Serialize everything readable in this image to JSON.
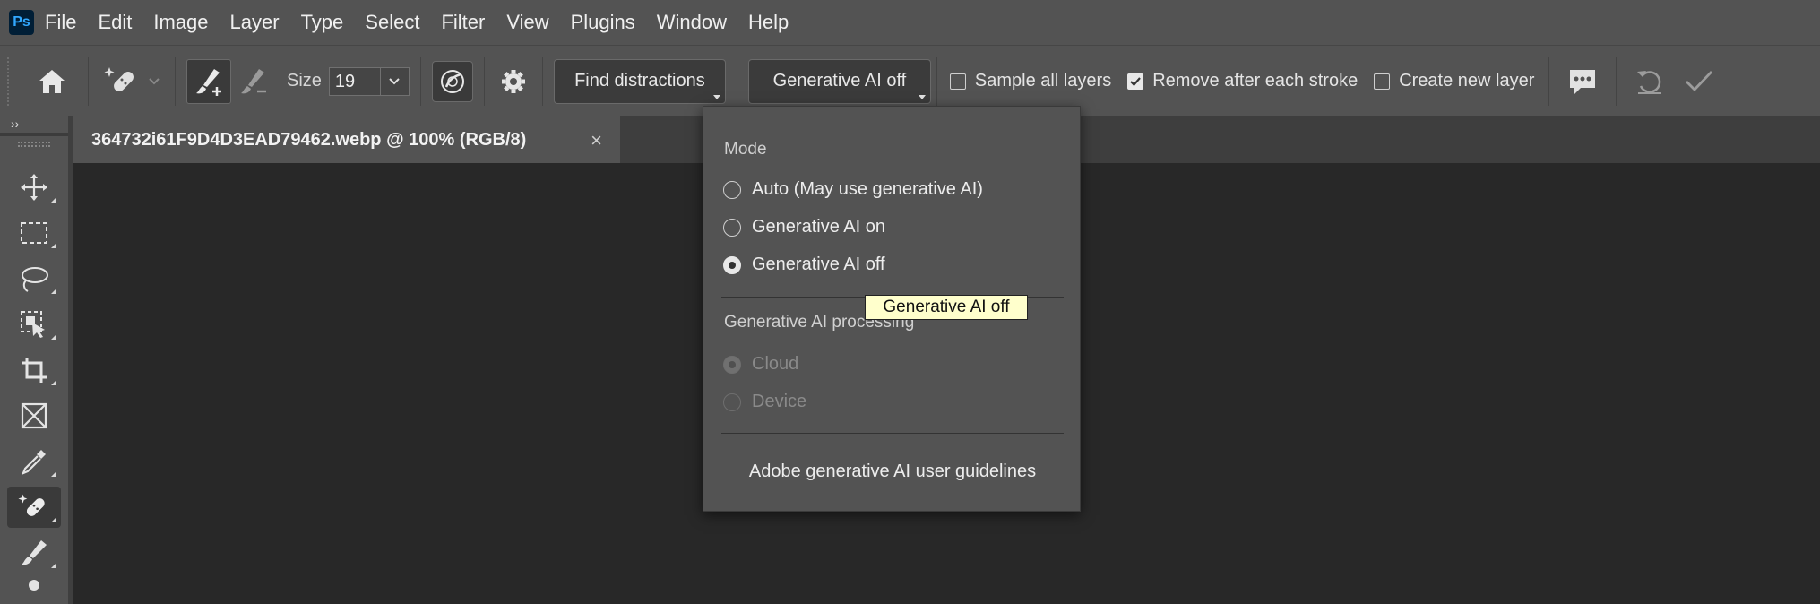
{
  "app": {
    "logo": "Ps"
  },
  "menubar": {
    "items": [
      "File",
      "Edit",
      "Image",
      "Layer",
      "Type",
      "Select",
      "Filter",
      "View",
      "Plugins",
      "Window",
      "Help"
    ]
  },
  "options": {
    "size_label": "Size",
    "size_value": "19",
    "find_distractions": "Find distractions",
    "gen_ai_button": "Generative AI off",
    "sample_all_layers": "Sample all layers",
    "remove_after_stroke": "Remove after each stroke",
    "create_new_layer": "Create new layer",
    "checks": {
      "sample_all_layers": false,
      "remove_after_stroke": true,
      "create_new_layer": false
    }
  },
  "panel": {
    "collapse_glyph": "››"
  },
  "document": {
    "tab_title": "364732i61F9D4D3EAD79462.webp @ 100% (RGB/8)",
    "close_glyph": "×"
  },
  "dropdown": {
    "mode_title": "Mode",
    "modes": [
      "Auto (May use generative AI)",
      "Generative AI on",
      "Generative AI off"
    ],
    "selected_mode": "Generative AI off",
    "processing_title": "Generative AI processing",
    "processing": [
      "Cloud",
      "Device"
    ],
    "guidelines": "Adobe generative AI user guidelines"
  },
  "tooltip": "Generative AI off",
  "colors": {
    "chrome": "#535353",
    "canvas": "#282828",
    "tooltip_bg": "#ffffcc",
    "logo_bg": "#001e36",
    "logo_fg": "#31a8ff"
  }
}
